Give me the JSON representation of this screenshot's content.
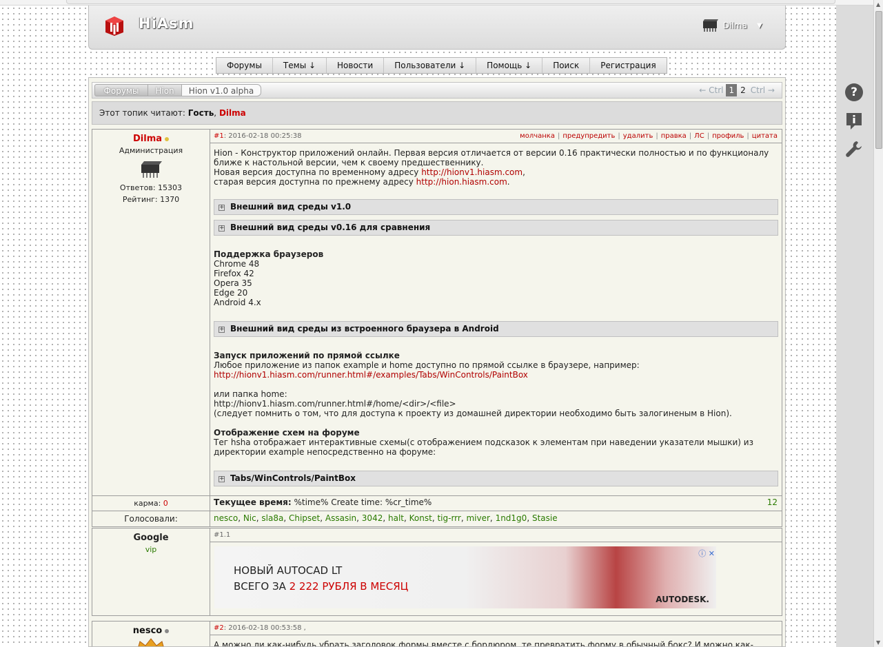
{
  "site": {
    "brand": "HiAsm",
    "user": "Dilma",
    "user_chevron": "▼"
  },
  "nav": [
    "Форумы",
    "Темы ↓",
    "Новости",
    "Пользователи ↓",
    "Помощь ↓",
    "Поиск",
    "Регистрация"
  ],
  "breadcrumbs": [
    "Форумы",
    "Hion",
    "Hion v1.0 alpha"
  ],
  "pager": {
    "prev": "← Ctrl",
    "current": "1",
    "next_page": "2",
    "next": "Ctrl →"
  },
  "readers": {
    "label": "Этот топик читают:",
    "guest": "Гость",
    "user": "Dilma"
  },
  "side_icons": {
    "help": "?"
  },
  "post1": {
    "author": "Dilma",
    "role": "Администрация",
    "answers": "Ответов: 15303",
    "rating": "Рейтинг: 1370",
    "num": "#1",
    "date": ": 2016-02-18 00:25:38",
    "actions": [
      "молчанка",
      "предупредить",
      "удалить",
      "правка",
      "ЛС",
      "профиль",
      "цитата"
    ],
    "p1": "Hion - Конструктор приложений онлайн. Первая версия отличается от версии 0.16 практически полностью и по функционалу ближе к настольной версии, чем к своему предшественнику.",
    "p2": "Новая версия доступна по временному адресу ",
    "link1": "http://hionv1.hiasm.com",
    "p2_end": ",",
    "p3": "старая версия доступна по прежнему адресу ",
    "link2": "http://hion.hiasm.com",
    "p3_end": ".",
    "spoiler1": "Внешний вид среды v1.0",
    "spoiler2": "Внешний вид среды v0.16 для сравнения",
    "browsers_title": "Поддержка браузеров",
    "browsers": [
      "Chrome 48",
      "Firefox 42",
      "Opera 35",
      "Edge 20",
      "Android 4.x"
    ],
    "spoiler3": "Внешний вид среды из встроенного браузера в Android",
    "launch_title": "Запуск приложений по прямой ссылке",
    "launch_text": "Любое приложение из папок example и home доступно по прямой ссылке в браузере, например:",
    "launch_link": "http://hionv1.hiasm.com/runner.html#/examples/Tabs/WinControls/PaintBox",
    "home_label": "или папка home:",
    "home_url": "http://hionv1.hiasm.com/runner.html#/home/<dir>/<file>",
    "home_note": "(следует помнить о том, что для доступа к проекту из домашней директории необходимо быть залогиненым в Hion).",
    "schemes_title": "Отображение схем на форуме",
    "schemes_text": "Тег hsha отображает интерактивные схемы(с отображением подсказок к элементам при наведении указатели мышки) из директории example непосредственно на форуме:",
    "spoiler4": "Tabs/WinControls/PaintBox",
    "karma_label": "карма: ",
    "karma_value": "0",
    "time_label": "Текущее время:",
    "time_value": " %time% Create time: %cr_time%",
    "votes_count": "12",
    "voted_label": "Голосовали:",
    "voters": [
      "nesco",
      "Nic",
      "sla8a",
      "Chipset",
      "Assasin",
      "3042",
      "halt",
      "Konst",
      "tig-rrr",
      "miver",
      "1nd1g0",
      "Stasie"
    ]
  },
  "post_ad": {
    "author": "Google",
    "role": "vip",
    "num": "#1.1",
    "line1": "НОВЫЙ AUTOCAD LT",
    "line2_a": "ВСЕГО ЗА ",
    "line2_b": "2 222 РУБЛЯ В МЕСЯЦ",
    "brand": "AUTODESK.",
    "close": "ⓘ ✕"
  },
  "post2": {
    "author": "nesco",
    "num": "#2",
    "date": ": 2016-02-18 00:53:58 ,",
    "text": "А можно ли как-нибудь убрать заголовок формы вместе с бордюром, те превратить форму в обычный бокс? И можно как-"
  }
}
